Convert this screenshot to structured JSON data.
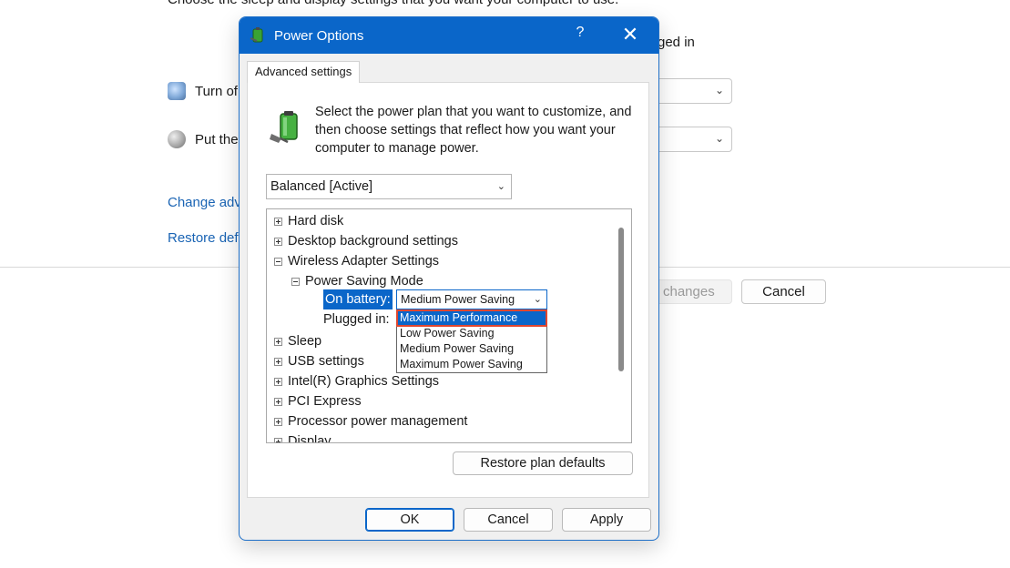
{
  "background": {
    "intro_text": "Choose the sleep and display settings that you want your computer to use.",
    "plugged_in_header": "ged in",
    "turn_off_label": "Turn of",
    "put_to_sleep_label": "Put the",
    "change_advanced_link": "Change adv",
    "restore_defaults_link": "Restore defa",
    "save_changes_button": "changes",
    "cancel_button": "Cancel",
    "icons": [
      "monitor-icon",
      "moon-icon",
      "chevron-down-icon"
    ]
  },
  "dialog": {
    "title": "Power Options",
    "help_glyph": "?",
    "close_glyph": "✕",
    "tab_label": "Advanced settings",
    "intro_text": "Select the power plan that you want to customize, and then choose settings that reflect how you want your computer to manage power.",
    "plan_select_value": "Balanced [Active]",
    "tree": {
      "items": [
        {
          "label": "Hard disk",
          "state": "collapsed"
        },
        {
          "label": "Desktop background settings",
          "state": "collapsed"
        },
        {
          "label": "Wireless Adapter Settings",
          "state": "expanded"
        },
        {
          "label": "Power Saving Mode",
          "state": "expanded"
        },
        {
          "label": "Sleep",
          "state": "collapsed"
        },
        {
          "label": "USB settings",
          "state": "collapsed"
        },
        {
          "label": "Intel(R) Graphics Settings",
          "state": "collapsed"
        },
        {
          "label": "PCI Express",
          "state": "collapsed"
        },
        {
          "label": "Processor power management",
          "state": "collapsed"
        },
        {
          "label": "Display",
          "state": "collapsed"
        }
      ],
      "on_battery_label": "On battery:",
      "on_battery_value": "Medium Power Saving",
      "plugged_in_label": "Plugged in:",
      "dropdown_options": [
        "Maximum Performance",
        "Low Power Saving",
        "Medium Power Saving",
        "Maximum Power Saving"
      ],
      "highlighted_option": "Maximum Performance"
    },
    "restore_plan_defaults_button": "Restore plan defaults",
    "ok_button": "OK",
    "cancel_button": "Cancel",
    "apply_button": "Apply",
    "colors": {
      "accent": "#0a66c9",
      "link": "#1a64b4",
      "highlight_outline": "#e0472f"
    }
  }
}
